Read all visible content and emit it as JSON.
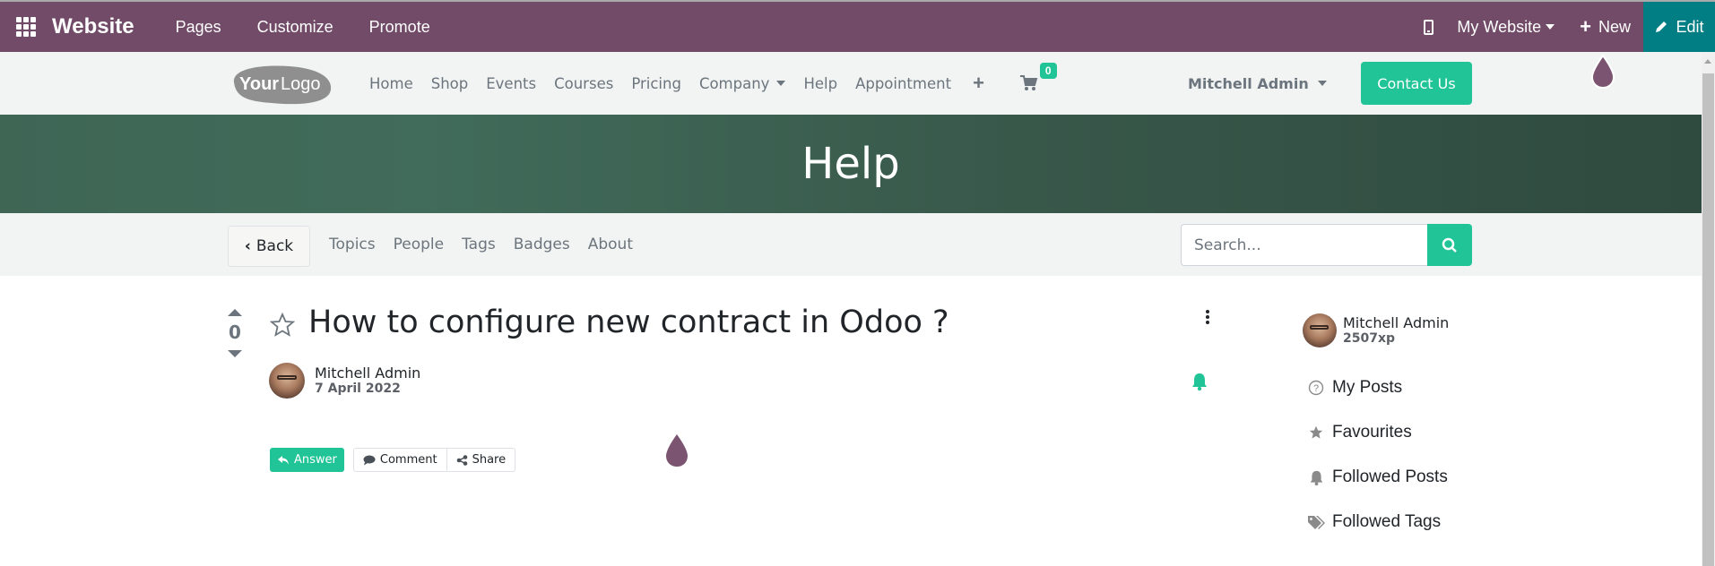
{
  "topbar": {
    "app_name": "Website",
    "menu": [
      "Pages",
      "Customize",
      "Promote"
    ],
    "website_selector": "My Website",
    "new_label": "New",
    "edit_label": "Edit",
    "colors": {
      "bar": "#714B67",
      "edit": "#017e84"
    }
  },
  "header": {
    "logo_text_bold": "Your",
    "logo_text_light": "Logo",
    "nav": [
      "Home",
      "Shop",
      "Events",
      "Courses",
      "Pricing",
      "Company",
      "Help",
      "Appointment"
    ],
    "cart_count": "0",
    "user_name": "Mitchell Admin",
    "contact_label": "Contact Us",
    "accent": "#21c496"
  },
  "banner": {
    "title": "Help"
  },
  "subnav": {
    "back_label": "Back",
    "links": [
      "Topics",
      "People",
      "Tags",
      "Badges",
      "About"
    ],
    "search_placeholder": "Search..."
  },
  "question": {
    "votes": "0",
    "title": "How to configure new contract in Odoo ?",
    "author": "Mitchell Admin",
    "date": "7 April 2022",
    "actions": {
      "answer": "Answer",
      "comment": "Comment",
      "share": "Share"
    }
  },
  "sidebar": {
    "user_name": "Mitchell Admin",
    "xp": "2507xp",
    "items": [
      {
        "label": "My Posts",
        "icon": "question-circle-icon"
      },
      {
        "label": "Favourites",
        "icon": "star-icon"
      },
      {
        "label": "Followed Posts",
        "icon": "bell-icon"
      },
      {
        "label": "Followed Tags",
        "icon": "tags-icon"
      }
    ]
  }
}
